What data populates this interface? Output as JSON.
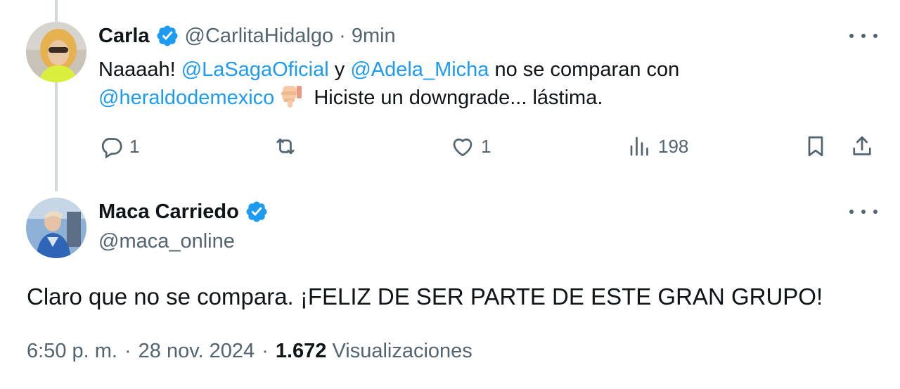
{
  "colors": {
    "accent": "#1d9bf0",
    "muted": "#536471",
    "text": "#0f1419",
    "thread_line": "#cfd9de"
  },
  "parent_tweet": {
    "author_name": "Carla",
    "handle": "@CarlitaHidalgo",
    "separator": "·",
    "time_ago": "9min",
    "text": {
      "part1": "Naaaah! ",
      "mention1": "@LaSagaOficial",
      "part2": " y ",
      "mention2": "@Adela_Micha",
      "part3": " no se comparan con",
      "mention3": "@heraldodemexico",
      "emoji": "thumbs-down-emoji",
      "part4": " Hiciste un downgrade... lástima."
    },
    "actions": {
      "replies": "1",
      "reposts": "",
      "likes": "1",
      "views": "198"
    },
    "icons": [
      "reply-icon",
      "repost-icon",
      "like-icon",
      "views-icon",
      "bookmark-icon",
      "share-icon",
      "more-icon",
      "verified-icon"
    ]
  },
  "reply_tweet": {
    "author_name": "Maca Carriedo",
    "handle": "@maca_online",
    "text": "Claro que no se compara. ¡FELIZ DE SER PARTE DE ESTE GRAN GRUPO!",
    "time": "6:50 p. m.",
    "date": "28 nov. 2024",
    "separator": "·",
    "views_count": "1.672",
    "views_label": "Visualizaciones"
  }
}
